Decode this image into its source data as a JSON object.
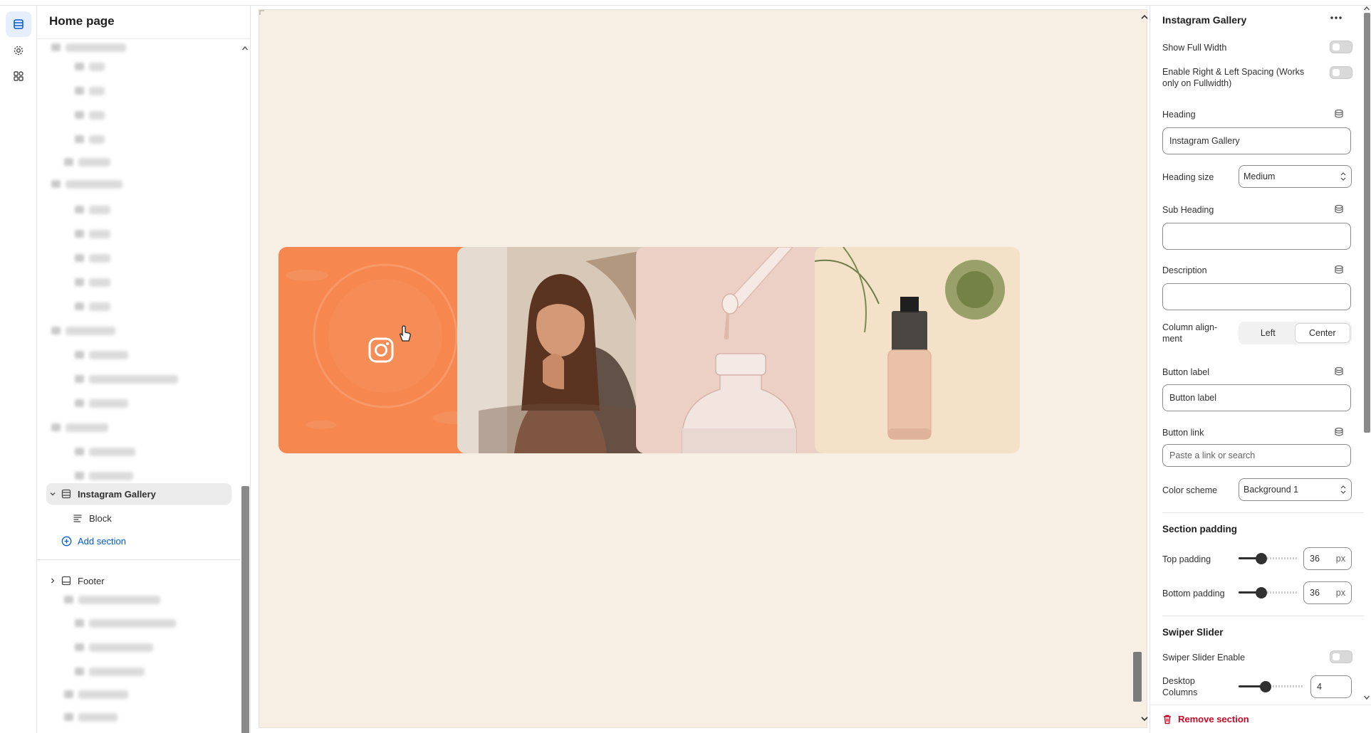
{
  "tree": {
    "title": "Home page",
    "selected_section": "Instagram Gallery",
    "block_label": "Block",
    "add_section": "Add section",
    "footer_label": "Footer"
  },
  "settings": {
    "title": "Instagram Gallery",
    "show_full_width": {
      "label": "Show Full Width",
      "on": false
    },
    "enable_spacing": {
      "label_line1": "Enable Right & Left Spacing (Works",
      "label_line2": "only on Fullwidth)",
      "on": false
    },
    "heading": {
      "label": "Heading",
      "value": "Instagram Gallery"
    },
    "heading_size": {
      "label": "Heading size",
      "value": "Medium"
    },
    "sub_heading": {
      "label": "Sub Heading",
      "value": ""
    },
    "description": {
      "label": "Description",
      "value": ""
    },
    "column_alignment": {
      "label_line1": "Column align-",
      "label_line2": "ment",
      "options": [
        "Left",
        "Center"
      ],
      "selected": "Center"
    },
    "button_label": {
      "label": "Button label",
      "value": "Button label"
    },
    "button_link": {
      "label": "Button link",
      "placeholder": "Paste a link or search"
    },
    "color_scheme": {
      "label": "Color scheme",
      "value": "Background 1"
    },
    "section_padding": {
      "heading": "Section padding",
      "top": {
        "label": "Top padding",
        "value": "36",
        "unit": "px",
        "fraction": 0.36
      },
      "bottom": {
        "label": "Bottom padding",
        "value": "36",
        "unit": "px",
        "fraction": 0.36
      }
    },
    "swiper": {
      "heading": "Swiper Slider",
      "enable": {
        "label": "Swiper Slider Enable",
        "on": false
      },
      "desktop_columns": {
        "label_line1": "Desktop",
        "label_line2": "Columns",
        "value": "4",
        "fraction": 0.4
      }
    },
    "remove_section": "Remove section"
  },
  "colors": {
    "accent": "#005bd3",
    "preview_bg": "#f7efe4",
    "instagram_tile": "#f5874f",
    "danger": "#c70a24"
  }
}
